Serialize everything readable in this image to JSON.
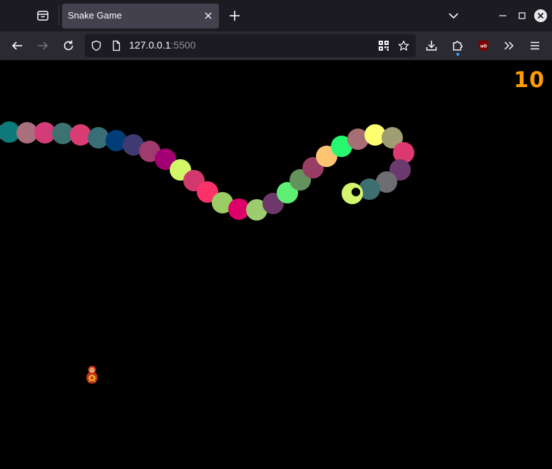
{
  "browser": {
    "tab_title": "Snake Game",
    "url_host": "127.0.0.1",
    "url_port": ":5500"
  },
  "game": {
    "score": "10",
    "score_color": "#ff9d00",
    "food_icon": "matryoshka-doll-icon",
    "snake_colors": [
      "#e44d8a",
      "#0c7a7a",
      "#a8707c",
      "#d33c78",
      "#3d7272",
      "#db3c74",
      "#3a6e76",
      "#013e78",
      "#403a72",
      "#9f3b6e",
      "#a30073",
      "#d3f668",
      "#d1386f",
      "#fb3268",
      "#9acd63",
      "#de0069",
      "#9ccc6d",
      "#6c3769",
      "#5fef75",
      "#63925d",
      "#983d63",
      "#fdc472",
      "#27f86f",
      "#a56f73",
      "#ffff72",
      "#9e9d73",
      "#dd386f",
      "#6a3a6f",
      "#6e6e72",
      "#3d6e70",
      "#d4f66c"
    ]
  }
}
